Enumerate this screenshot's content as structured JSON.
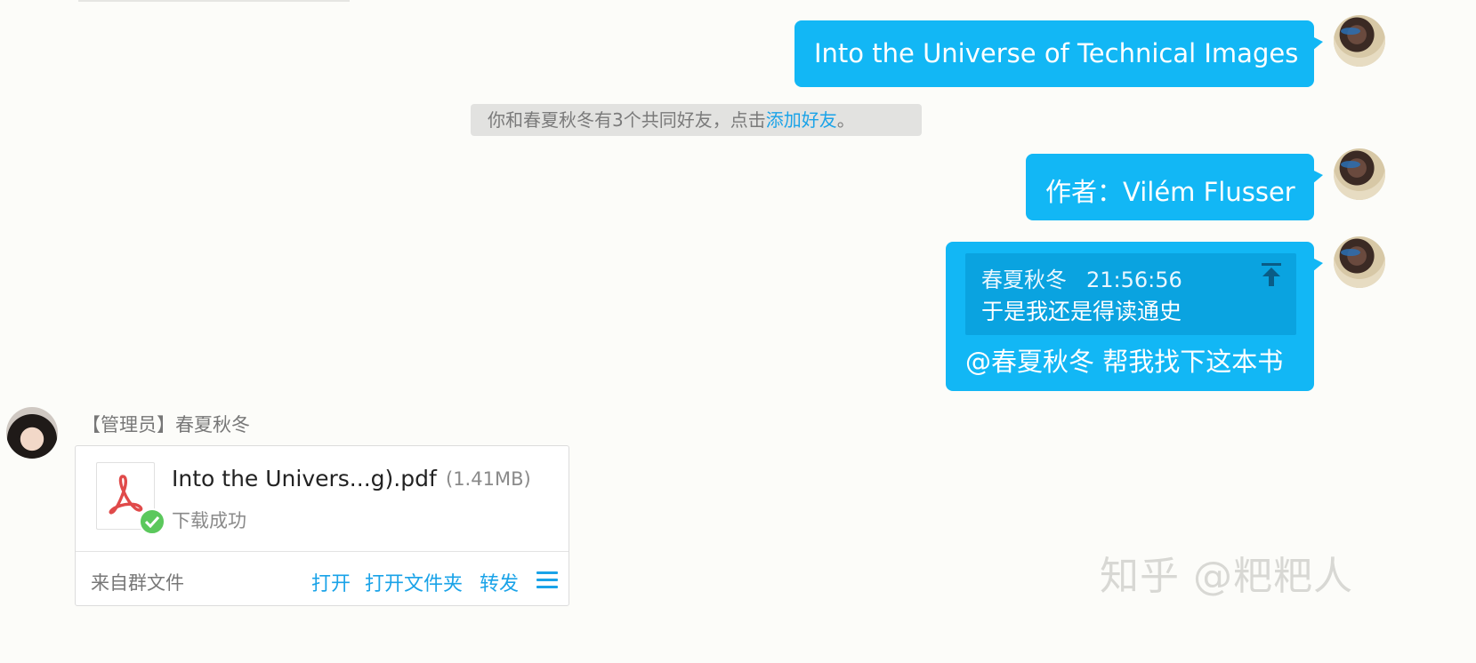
{
  "messages": {
    "m1": "Into the Universe of Technical Images",
    "m2": "作者：Vilém Flusser",
    "m3": {
      "quote_author": "春夏秋冬",
      "quote_time": "21:56:56",
      "quote_text": "于是我还是得读通史",
      "text": "@春夏秋冬 帮我找下这本书"
    }
  },
  "notice": {
    "text": "你和春夏秋冬有3个共同好友，点击",
    "link": "添加好友",
    "end": "。"
  },
  "file_message": {
    "sender": "【管理员】春夏秋冬",
    "file_name": "Into the Univers...g).pdf",
    "file_size": "(1.41MB)",
    "status": "下载成功",
    "source": "来自群文件",
    "actions": {
      "open": "打开",
      "open_folder": "打开文件夹",
      "forward": "转发"
    }
  },
  "watermark": "知乎 @粑粑人",
  "colors": {
    "bubble": "#12b7f5",
    "link": "#1aa3e8",
    "success": "#5bc85c",
    "pdf": "#e04a4a"
  },
  "icons": [
    "avatar",
    "pin-top-icon",
    "pdf-file-icon",
    "check-icon",
    "menu-icon"
  ]
}
